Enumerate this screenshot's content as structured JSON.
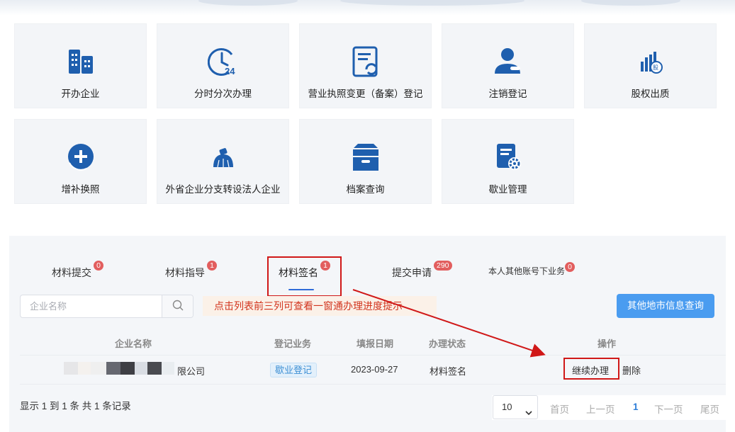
{
  "tiles": [
    {
      "label": "开办企业",
      "icon": "building-icon"
    },
    {
      "label": "分时分次办理",
      "icon": "clock-24-icon"
    },
    {
      "label": "营业执照变更（备案）登记",
      "icon": "document-refresh-icon"
    },
    {
      "label": "注销登记",
      "icon": "user-minus-icon"
    },
    {
      "label": "股权出质",
      "icon": "equity-chart-icon"
    },
    {
      "label": "增补换照",
      "icon": "add-circle-icon"
    },
    {
      "label": "外省企业分支转设法人企业",
      "icon": "branch-dome-icon"
    },
    {
      "label": "档案查询",
      "icon": "archive-box-icon"
    },
    {
      "label": "歇业管理",
      "icon": "document-gear-icon"
    }
  ],
  "tabs": [
    {
      "label": "材料提交",
      "count": "0"
    },
    {
      "label": "材料指导",
      "count": "1"
    },
    {
      "label": "材料签名",
      "count": "1"
    },
    {
      "label": "提交申请",
      "count": "290"
    },
    {
      "label": "本人其他账号下业务",
      "count": "0"
    }
  ],
  "search": {
    "placeholder": "企业名称"
  },
  "tip": "点击列表前三列可查看一窗通办理进度提示",
  "other_button": "其他地市信息查询",
  "table": {
    "headers": {
      "company": "企业名称",
      "business": "登记业务",
      "date": "填报日期",
      "status": "办理状态",
      "action": "操作"
    },
    "rows": [
      {
        "company_suffix": "限公司",
        "business": "歇业登记",
        "date": "2023-09-27",
        "status": "材料签名",
        "continue": "继续办理",
        "delete": "删除"
      }
    ]
  },
  "footer": {
    "summary": "显示 1 到 1 条 共 1 条记录"
  },
  "pagination": {
    "page_size": "10",
    "first": "首页",
    "prev": "上一页",
    "current": "1",
    "next": "下一页",
    "last": "尾页"
  },
  "colors": {
    "accent": "#2f6bd8",
    "icon_blue": "#1f5fae",
    "badge": "#e25e5e",
    "highlight_red": "#d01818",
    "button_blue": "#4a9cf0"
  }
}
